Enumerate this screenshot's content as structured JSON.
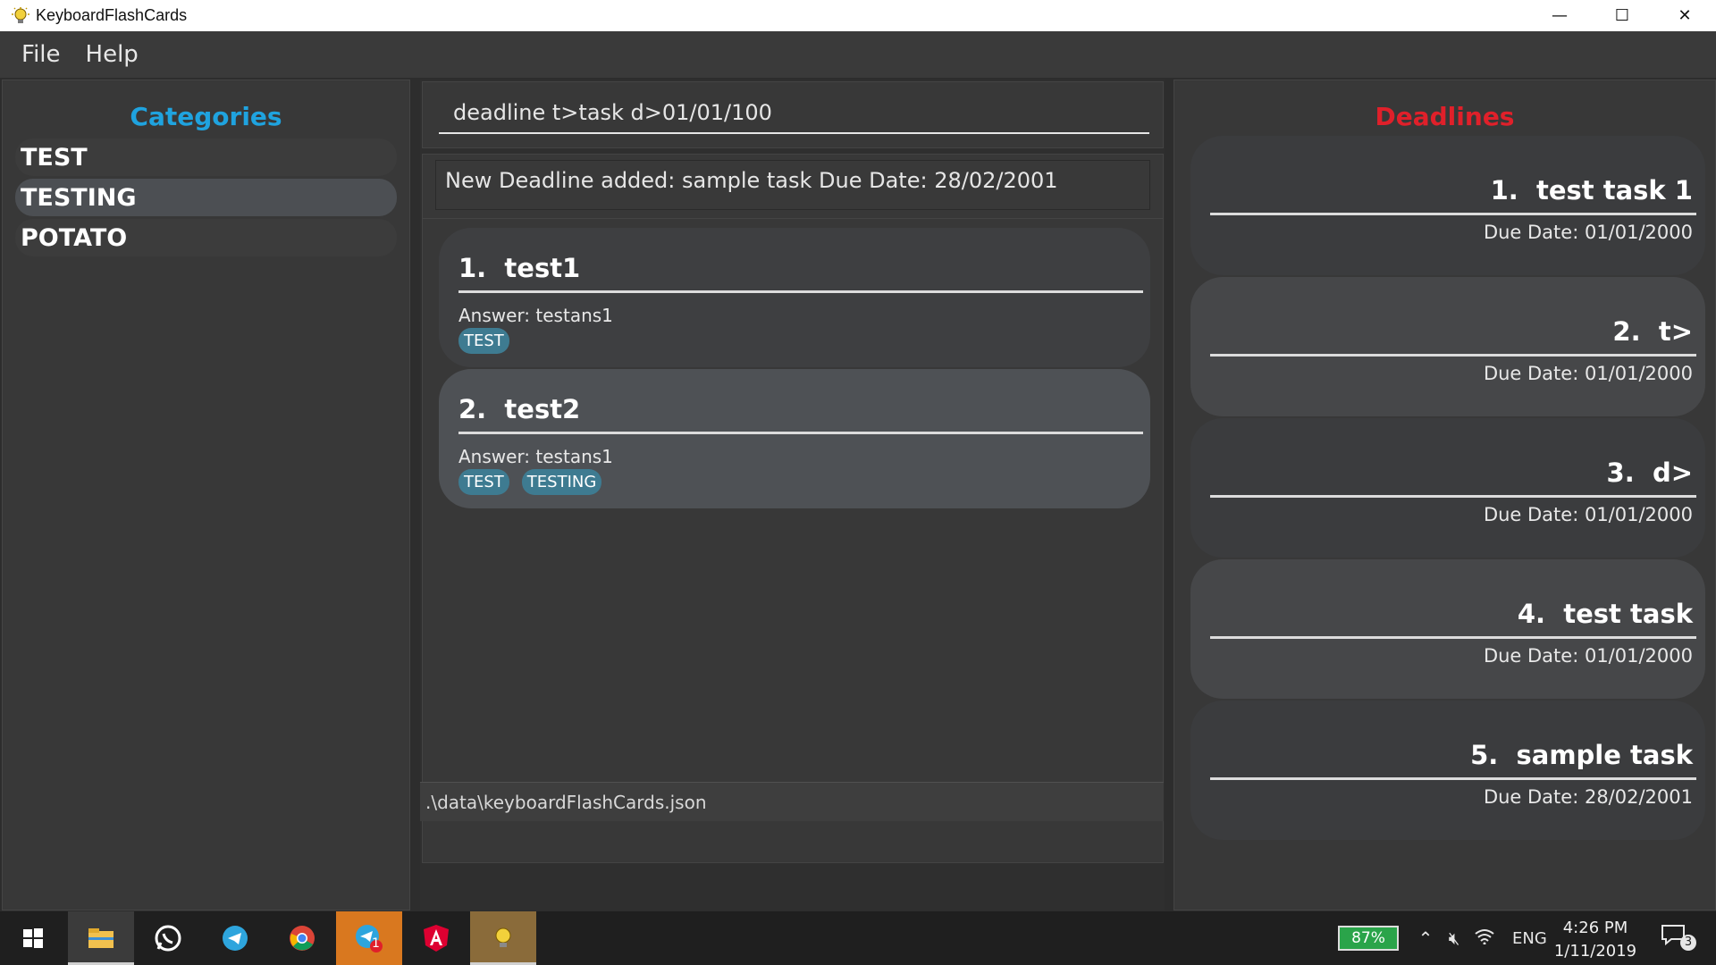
{
  "window": {
    "title": "KeyboardFlashCards",
    "controls": {
      "minimize": "—",
      "maximize": "☐",
      "close": "✕"
    }
  },
  "menu": {
    "file": "File",
    "help": "Help"
  },
  "categories": {
    "title": "Categories",
    "title_color": "#1fa3df",
    "items": [
      {
        "label": "TEST"
      },
      {
        "label": "TESTING"
      },
      {
        "label": "POTATO"
      }
    ]
  },
  "command": {
    "value": "deadline t>task d>01/01/100"
  },
  "result": {
    "text": "New Deadline added: sample task Due Date: 28/02/2001"
  },
  "flashcards": [
    {
      "number": "1.",
      "question": "test1",
      "answer": "Answer: testans1",
      "tags": [
        "TEST"
      ]
    },
    {
      "number": "2.",
      "question": "test2",
      "answer": "Answer: testans1",
      "tags": [
        "TEST",
        "TESTING"
      ]
    }
  ],
  "status": {
    "path": ".\\data\\keyboardFlashCards.json"
  },
  "deadlines": {
    "title": "Deadlines",
    "title_color": "#e0202a",
    "items": [
      {
        "number": "1.",
        "task": "test task 1",
        "due": "Due Date: 01/01/2000"
      },
      {
        "number": "2.",
        "task": "t>",
        "due": "Due Date: 01/01/2000"
      },
      {
        "number": "3.",
        "task": "d>",
        "due": "Due Date: 01/01/2000"
      },
      {
        "number": "4.",
        "task": "test task",
        "due": "Due Date: 01/01/2000"
      },
      {
        "number": "5.",
        "task": "sample task",
        "due": "Due Date: 28/02/2001"
      }
    ]
  },
  "taskbar": {
    "battery": "87%",
    "language": "ENG",
    "time": "4:26 PM",
    "date": "1/11/2019",
    "telegram_badge": "1",
    "notification_count": "3"
  }
}
